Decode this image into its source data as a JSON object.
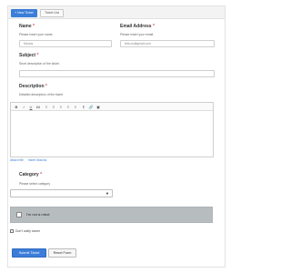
{
  "tabs": {
    "new_ticket": "+ New Ticket",
    "ticket_list": "Ticket List"
  },
  "form": {
    "name": {
      "label": "Name",
      "required": "*",
      "hint": "Please insert your name.",
      "value": "Moons"
    },
    "email": {
      "label": "Email Address",
      "required": "*",
      "hint": "Please insert your email.",
      "value": "test.us@gmail.com"
    },
    "subject": {
      "label": "Subject",
      "required": "*",
      "hint": "Short description of the ticket.",
      "value": ""
    },
    "description": {
      "label": "Description",
      "required": "*",
      "hint": "Detailed description of the ticket",
      "toolbar": [
        "B",
        "I",
        "U",
        "66",
        "≡",
        "≡",
        "≡",
        "≡",
        "≡",
        "¶",
        "🔗",
        "▣"
      ],
      "links": [
        "Attach file",
        "Insert Macros"
      ]
    },
    "category": {
      "label": "Category",
      "required": "*",
      "hint": "Please select category",
      "selected": "",
      "arrow": "▼"
    },
    "captcha": {
      "label": "I'm not a robot"
    },
    "notify": {
      "label": "Don't notify owner"
    },
    "buttons": {
      "submit": "Submit Ticket",
      "reset": "Reset Form"
    }
  }
}
